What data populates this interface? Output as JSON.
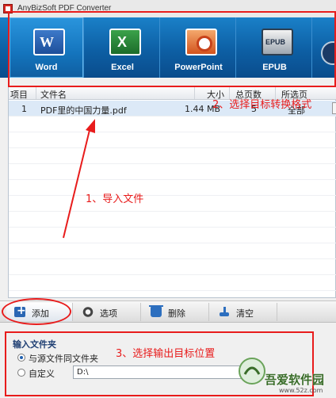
{
  "window": {
    "title": "AnyBizSoft PDF Converter"
  },
  "ribbon": {
    "buttons": [
      {
        "label": "Word",
        "icon": "word-icon"
      },
      {
        "label": "Excel",
        "icon": "excel-icon"
      },
      {
        "label": "PowerPoint",
        "icon": "powerpoint-icon"
      },
      {
        "label": "EPUB",
        "icon": "epub-icon"
      }
    ]
  },
  "file_list": {
    "columns": [
      "项目",
      "文件名",
      "大小",
      "总页数",
      "所选页"
    ],
    "rows": [
      {
        "index": "1",
        "name": "PDF里的中国力量.pdf",
        "size": "1.44 MB",
        "pages": "5",
        "selected": "全部"
      }
    ]
  },
  "toolbar": {
    "add_label": "添加",
    "options_label": "选项",
    "delete_label": "删除",
    "clear_label": "清空"
  },
  "output": {
    "title": "输入文件夹",
    "option_same": "与源文件同文件夹",
    "option_custom": "自定义",
    "path_value": "D:\\",
    "browse_label": "..."
  },
  "annotations": {
    "step1": "1、导入文件",
    "step2": "2、选择目标转换格式",
    "step3": "3、选择输出目标位置",
    "color": "#e81c1c"
  },
  "watermark": {
    "text": "吾爱软件园",
    "url": "www.52z.com"
  },
  "colors": {
    "ribbon": "#0d5fa4",
    "accent": "#e81c1c"
  }
}
